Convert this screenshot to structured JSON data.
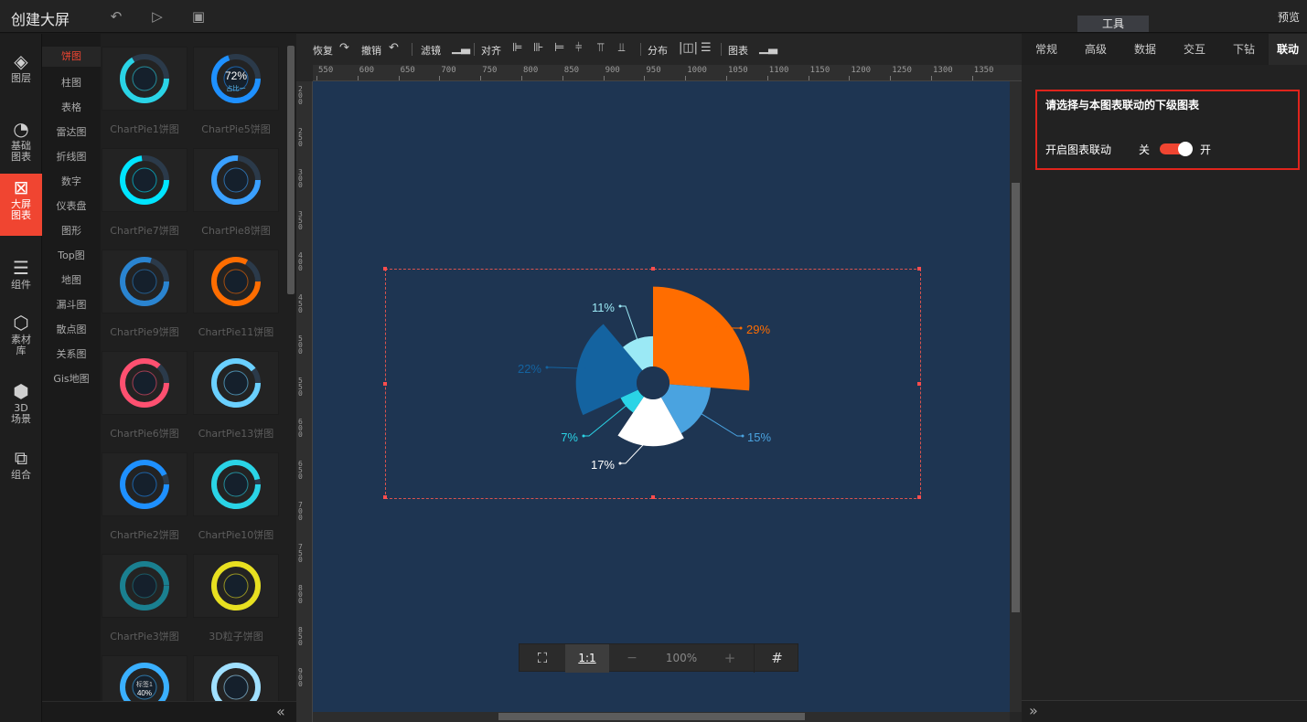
{
  "app": {
    "title": "创建大屏",
    "tools_tab": "工具",
    "preview": "预览"
  },
  "left_nav": [
    {
      "label": "图层",
      "icon": "layers-icon",
      "glyph": "◈"
    },
    {
      "label": "基础\n图表",
      "icon": "pie-chart-icon",
      "glyph": "◔"
    },
    {
      "label": "大屏\n图表",
      "icon": "screen-chart-icon",
      "glyph": "⊠"
    },
    {
      "label": "组件",
      "icon": "sliders-icon",
      "glyph": "☰"
    },
    {
      "label": "素材\n库",
      "icon": "hexagons-icon",
      "glyph": "⬡"
    },
    {
      "label": "3D\n场景",
      "icon": "cube-icon",
      "glyph": "⬢"
    },
    {
      "label": "组合",
      "icon": "group-icon",
      "glyph": "⧉"
    }
  ],
  "categories": [
    "饼图",
    "柱图",
    "表格",
    "雷达图",
    "折线图",
    "数字",
    "仪表盘",
    "图形",
    "Top图",
    "地图",
    "漏斗图",
    "散点图",
    "关系图",
    "Gis地图"
  ],
  "chart_cards": [
    {
      "label": "ChartPie1饼图"
    },
    {
      "label": "ChartPie5饼图"
    },
    {
      "label": "ChartPie7饼图"
    },
    {
      "label": "ChartPie8饼图"
    },
    {
      "label": "ChartPie9饼图"
    },
    {
      "label": "ChartPie11饼图"
    },
    {
      "label": "ChartPie6饼图"
    },
    {
      "label": "ChartPie13饼图"
    },
    {
      "label": "ChartPie2饼图"
    },
    {
      "label": "ChartPie10饼图"
    },
    {
      "label": "ChartPie3饼图"
    },
    {
      "label": "3D粒子饼图"
    },
    {
      "label": ""
    },
    {
      "label": ""
    }
  ],
  "card_texts": {
    "pie5_value": "72%",
    "pie5_sub": "占比一",
    "last_value": "40%",
    "last_sub": "标签1"
  },
  "toolbar": {
    "restore": "恢复",
    "undo": "撤销",
    "filter": "滤镜",
    "align": "对齐",
    "distribute": "分布",
    "chart": "图表"
  },
  "ruler_h": [
    "550",
    "600",
    "650",
    "700",
    "750",
    "800",
    "850",
    "900",
    "950",
    "1000",
    "1050",
    "1100",
    "1150",
    "1200",
    "1250",
    "1300",
    "1350"
  ],
  "ruler_v": [
    "200",
    "250",
    "300",
    "350",
    "400",
    "450",
    "500",
    "550",
    "600",
    "650",
    "700",
    "750",
    "800",
    "850",
    "900"
  ],
  "zoom": {
    "value": "100%",
    "one_to_one": "1:1",
    "minus": "−",
    "plus": "+"
  },
  "right_tabs": [
    "常规",
    "高级",
    "数据",
    "交互",
    "下钻",
    "联动"
  ],
  "linkage": {
    "prompt": "请选择与本图表联动的下级图表",
    "enable_label": "开启图表联动",
    "off": "关",
    "on": "开",
    "enabled": true
  },
  "chart_data": {
    "type": "pie",
    "variant": "rose",
    "slices": [
      {
        "label": "29%",
        "value": 29,
        "color": "#ff6d00"
      },
      {
        "label": "15%",
        "value": 15,
        "color": "#4aa3e0"
      },
      {
        "label": "17%",
        "value": 17,
        "color": "#ffffff"
      },
      {
        "label": "7%",
        "value": 7,
        "color": "#2ad4e6"
      },
      {
        "label": "22%",
        "value": 22,
        "color": "#1463a0"
      },
      {
        "label": "11%",
        "value": 11,
        "color": "#9be9f5"
      }
    ]
  }
}
